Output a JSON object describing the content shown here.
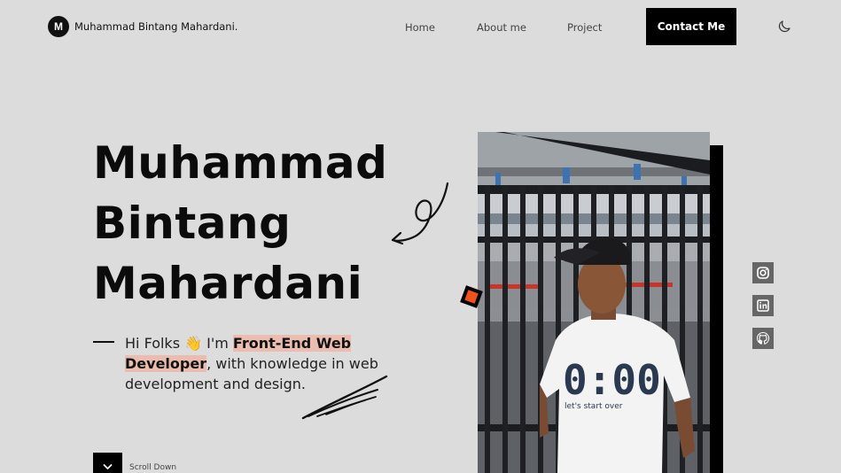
{
  "nav": {
    "logo_letter": "M",
    "brand": "Muhammad Bintang Mahardani.",
    "links": [
      "Home",
      "About me",
      "Project"
    ],
    "cta": "Contact Me",
    "theme_icon": "moon-icon"
  },
  "hero": {
    "title_lines": [
      "Muhammad",
      "Bintang",
      "Mahardani"
    ],
    "intro_prefix": "Hi Folks",
    "wave_emoji": "👋",
    "intro_mid": " I'm ",
    "role": "Front-End Web Developer",
    "intro_suffix": ", with knowledge in web development and design.",
    "scroll_label": "Scroll Down"
  },
  "photo": {
    "shirt_text": "0:00",
    "shirt_subtext": "let's start over"
  },
  "social": [
    "instagram-icon",
    "linkedin-icon",
    "github-icon"
  ],
  "colors": {
    "background": "#dcdcdc",
    "accent_highlight": "#ebbcb0",
    "deco_orange": "#f0521c",
    "dark": "#000000"
  }
}
